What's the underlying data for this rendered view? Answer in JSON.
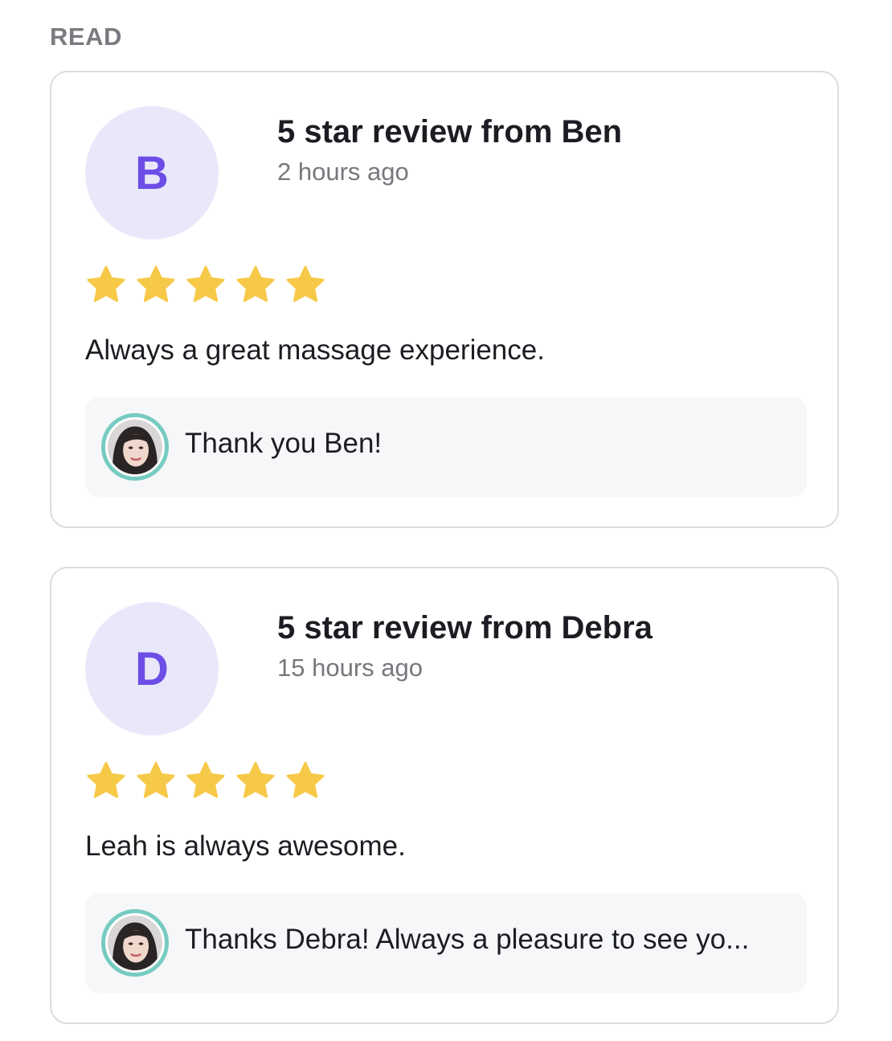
{
  "section": {
    "heading": "READ"
  },
  "colors": {
    "star": "#F7C948",
    "avatar_bg": "#E9E8FB",
    "avatar_letter": "#6C4EE6",
    "reply_ring": "#77CBC0"
  },
  "reviews": [
    {
      "initial": "B",
      "title": "5 star review from Ben",
      "time": "2 hours ago",
      "rating": 5,
      "text": "Always a great massage experience.",
      "reply": {
        "icon": "owner-avatar-photo",
        "text": "Thank you Ben!"
      }
    },
    {
      "initial": "D",
      "title": "5 star review from Debra",
      "time": "15 hours ago",
      "rating": 5,
      "text": "Leah is always awesome.",
      "reply": {
        "icon": "owner-avatar-photo",
        "text": "Thanks Debra! Always a pleasure to see yo..."
      }
    }
  ]
}
